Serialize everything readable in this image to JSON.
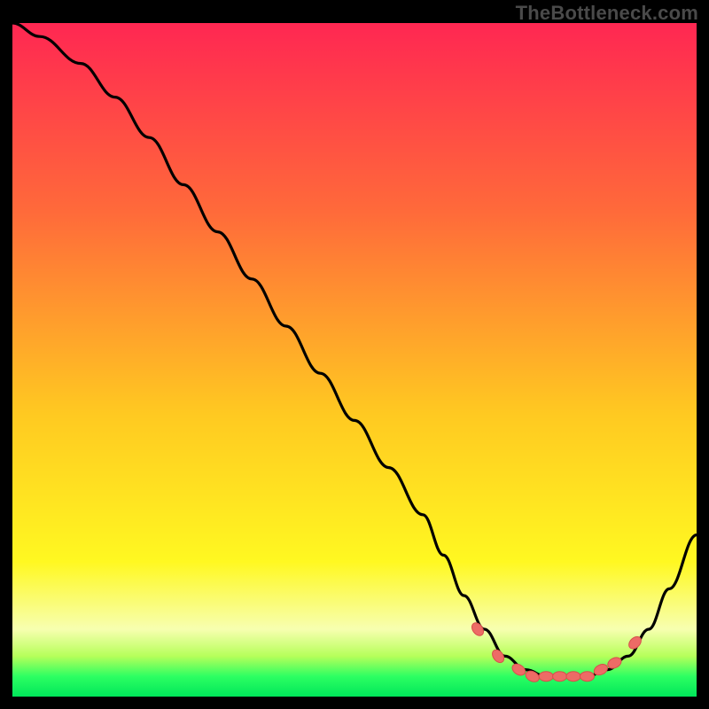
{
  "watermark": "TheBottleneck.com",
  "colors": {
    "bg": "#000000",
    "curve": "#000000",
    "marker_fill": "#ed6b66",
    "marker_stroke": "#d84f4a",
    "grad_top": "#ff2752",
    "grad_upper": "#ff6a3a",
    "grad_mid": "#ffc921",
    "grad_lower": "#fff821",
    "grad_pale": "#f7ffb0",
    "grad_green1": "#b6ff5a",
    "grad_green2": "#2dff62",
    "grad_bottom": "#00e65a"
  },
  "chart_data": {
    "type": "line",
    "title": "",
    "xlabel": "",
    "ylabel": "",
    "xlim": [
      0,
      100
    ],
    "ylim": [
      0,
      100
    ],
    "legend": false,
    "grid": false,
    "series": [
      {
        "name": "bottleneck-curve",
        "x": [
          0,
          4,
          10,
          15,
          20,
          25,
          30,
          35,
          40,
          45,
          50,
          55,
          60,
          63,
          66,
          69,
          72,
          75,
          78,
          81,
          84,
          87,
          90,
          93,
          96,
          100
        ],
        "y": [
          100,
          98,
          94,
          89,
          83,
          76,
          69,
          62,
          55,
          48,
          41,
          34,
          27,
          21,
          15,
          10,
          6,
          4,
          3,
          3,
          3,
          4,
          6,
          10,
          16,
          24
        ]
      }
    ],
    "markers": {
      "name": "highlight-points",
      "x": [
        68,
        71,
        74,
        76,
        78,
        80,
        82,
        84,
        86,
        88,
        91
      ],
      "y": [
        10,
        6,
        4,
        3,
        3,
        3,
        3,
        3,
        4,
        5,
        8
      ]
    }
  }
}
